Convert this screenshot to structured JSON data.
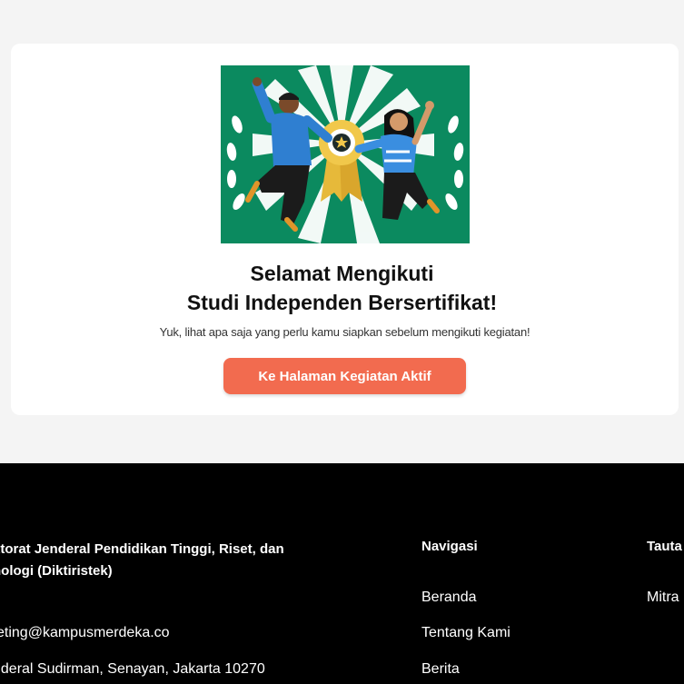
{
  "success_card": {
    "illustration_icon": "celebration-illustration",
    "title_line1": "Selamat Mengikuti",
    "title_line2": "Studi Independen Bersertifikat!",
    "subtitle": "Yuk, lihat apa saja yang perlu kamu siapkan sebelum mengikuti kegiatan!",
    "cta_label": "Ke Halaman Kegiatan Aktif"
  },
  "footer": {
    "org_name": "ktorat Jenderal Pendidikan Tinggi, Riset, dan\nnologi (Diktiristek)",
    "email": "keting@kampusmerdeka.co",
    "address": "nderal Sudirman, Senayan, Jakarta 10270",
    "nav": {
      "heading": "Navigasi",
      "items": [
        "Beranda",
        "Tentang Kami",
        "Berita"
      ]
    },
    "links": {
      "heading": "Tauta",
      "items": [
        "Mitra"
      ]
    }
  },
  "colors": {
    "accent": "#f26b4f",
    "illustration_bg": "#0b8a5f",
    "footer_bg": "#000000"
  }
}
